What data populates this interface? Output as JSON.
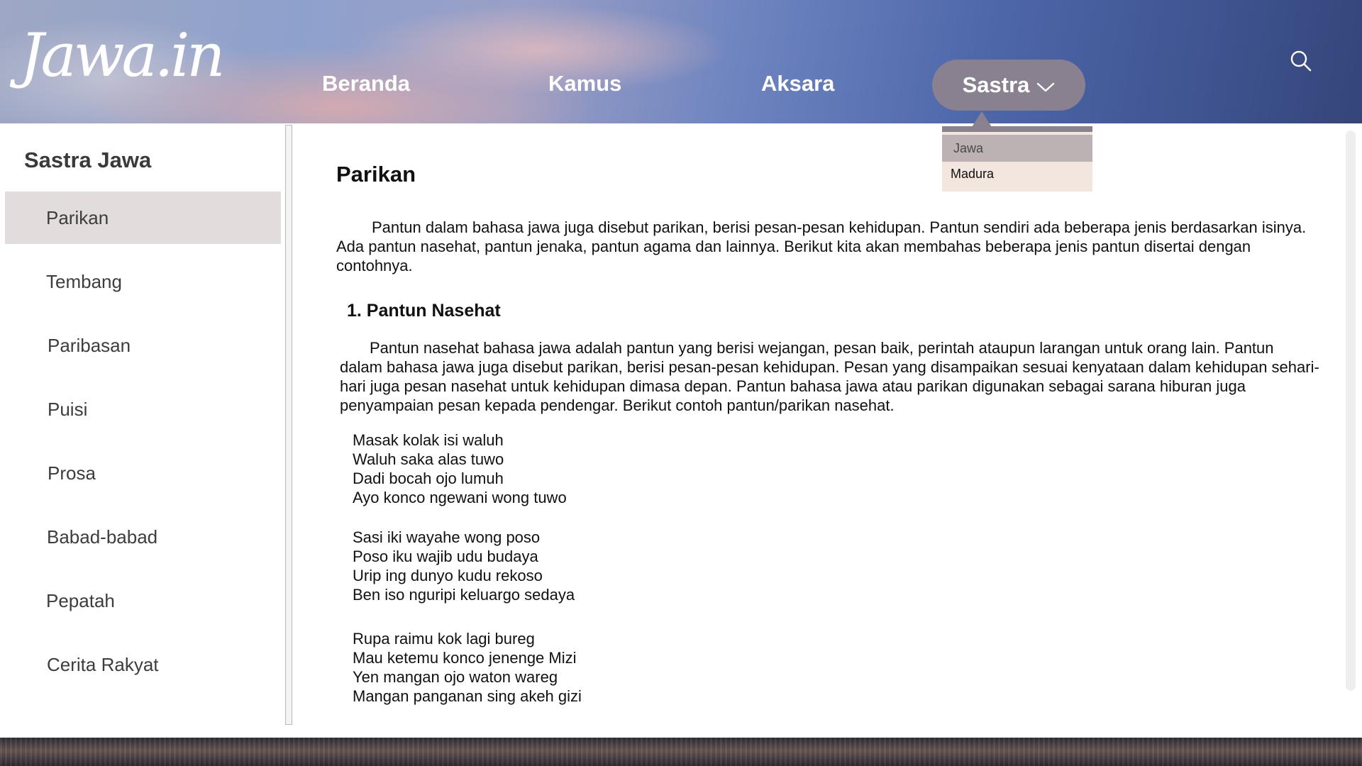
{
  "header": {
    "logo_text": "Jawa.in",
    "nav": {
      "beranda": "Beranda",
      "kamus": "Kamus",
      "aksara": "Aksara",
      "sastra": "Sastra"
    },
    "dropdown": {
      "items": [
        "Jawa",
        "Madura"
      ],
      "selected": "Jawa"
    }
  },
  "sidebar": {
    "title": "Sastra Jawa",
    "items": [
      "Parikan",
      "Tembang",
      "Paribasan",
      "Puisi",
      "Prosa",
      "Babad-babad",
      "Pepatah",
      "Cerita Rakyat"
    ],
    "active": "Parikan"
  },
  "content": {
    "title": "Parikan",
    "intro": "Pantun dalam bahasa jawa juga disebut parikan, berisi pesan-pesan kehidupan. Pantun sendiri ada beberapa jenis berdasarkan isinya. Ada pantun nasehat, pantun jenaka, pantun agama dan lainnya. Berikut kita akan membahas beberapa jenis pantun disertai dengan contohnya.",
    "section_heading": "1. Pantun Nasehat",
    "section_body": "Pantun nasehat bahasa jawa adalah pantun yang berisi wejangan, pesan baik, perintah ataupun larangan untuk orang lain. Pantun dalam bahasa jawa juga disebut parikan, berisi pesan-pesan kehidupan. Pesan yang disampaikan sesuai kenyataan dalam kehidupan sehari-hari juga pesan nasehat untuk kehidupan dimasa depan. Pantun bahasa jawa atau parikan digunakan sebagai sarana hiburan juga penyampaian pesan kepada pendengar. Berikut contoh pantun/parikan nasehat.",
    "stanzas": [
      [
        "Masak kolak isi waluh",
        "Waluh saka alas tuwo",
        "Dadi bocah ojo lumuh",
        "Ayo konco ngewani wong tuwo"
      ],
      [
        "Sasi iki wayahe wong poso",
        "Poso iku wajib udu budaya",
        "Urip ing dunyo kudu rekoso",
        "Ben iso nguripi keluargo sedaya"
      ],
      [
        "Rupa raimu kok lagi bureg",
        "Mau ketemu konco jenenge Mizi",
        "Yen mangan ojo waton wareg",
        "Mangan panganan sing akeh gizi"
      ]
    ]
  },
  "colors": {
    "nav_active_bg": "#8a8190",
    "sidebar_active_bg": "#e2dcdc",
    "dropdown_bg": "#f3e6df",
    "dropdown_selected_bg": "#bcb1b3"
  }
}
